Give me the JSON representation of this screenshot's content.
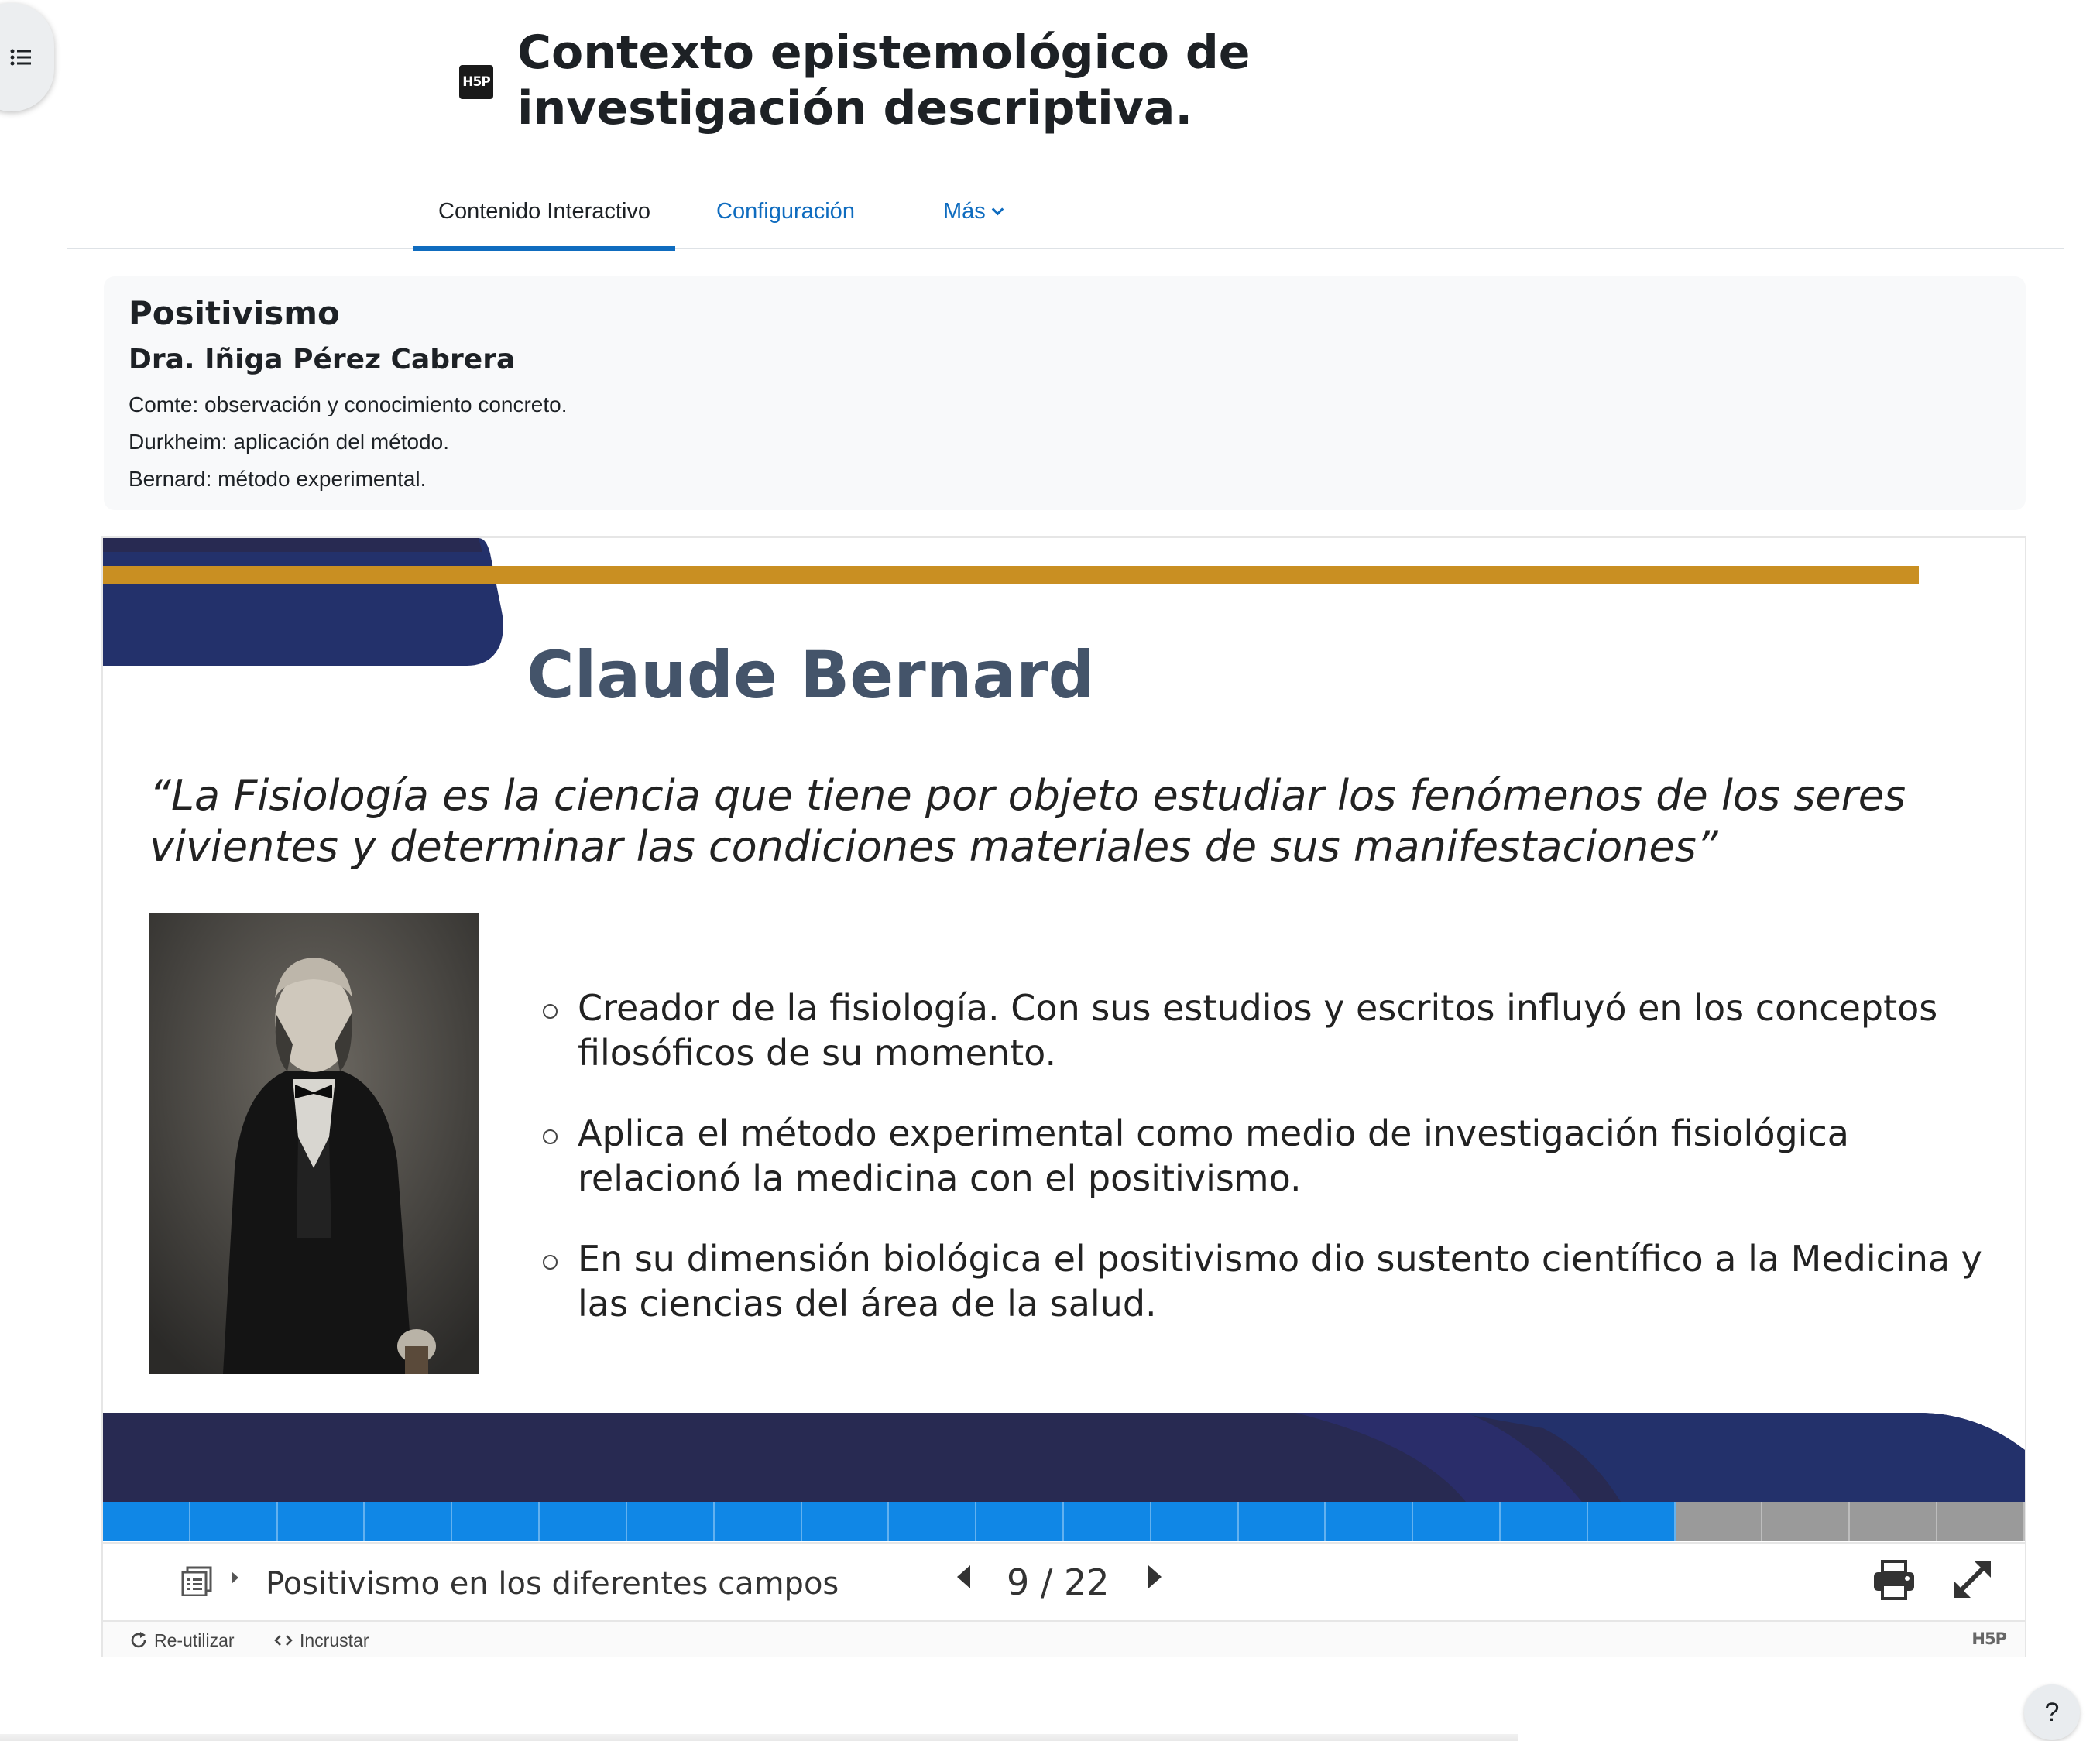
{
  "header": {
    "title": "Contexto epistemológico de investigación descriptiva.",
    "activity_icon_text": "H5P"
  },
  "tabs": [
    {
      "label": "Contenido Interactivo",
      "active": true
    },
    {
      "label": "Configuración",
      "active": false
    },
    {
      "label": "Más",
      "active": false
    }
  ],
  "intro": {
    "heading": "Positivismo",
    "author": "Dra. Iñiga Pérez Cabrera",
    "lines": [
      "Comte: observación y conocimiento concreto.",
      "Durkheim: aplicación del método.",
      "Bernard: método experimental."
    ]
  },
  "slide": {
    "title": "Claude Bernard",
    "quote": "“La Fisiología es la ciencia que tiene por objeto estudiar los fenómenos de los seres vivientes y determinar las condiciones materiales de sus manifestaciones”",
    "bullets": [
      "Creador de la fisiología. Con sus estudios y escritos influyó en los conceptos filosóficos de su momento.",
      "Aplica el método experimental como medio de investigación fisiológica relacionó la medicina con el positivismo.",
      "En su dimensión biológica el positivismo dio sustento científico a la Medicina y las ciencias del área de la salud."
    ],
    "colors": {
      "navy": "#23316b",
      "dark_navy": "#282a52",
      "gold": "#c98f22",
      "title_gray": "#44546a"
    }
  },
  "progress": {
    "current": 9,
    "total": 22,
    "segments_total": 22,
    "segments_done": 18,
    "done_color": "#1087e6",
    "todo_color": "#9a9a9a"
  },
  "navbar": {
    "slide_label": "Positivismo en los diferentes campos",
    "page_current": "9",
    "page_separator": "/",
    "page_total": "22",
    "icons": [
      "keywords-icon",
      "prev-arrow-icon",
      "next-arrow-icon",
      "print-icon",
      "fullscreen-icon"
    ]
  },
  "actions": {
    "reuse_label": "Re-utilizar",
    "embed_label": "Incrustar",
    "logo": "H5P"
  },
  "help": {
    "label": "?"
  }
}
